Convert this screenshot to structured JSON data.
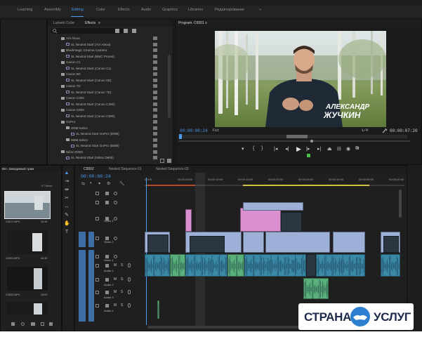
{
  "workspaces": [
    {
      "label": "Learning",
      "active": false
    },
    {
      "label": "Assembly",
      "active": false
    },
    {
      "label": "Editing",
      "active": true
    },
    {
      "label": "Color",
      "active": false
    },
    {
      "label": "Effects",
      "active": false
    },
    {
      "label": "Audio",
      "active": false
    },
    {
      "label": "Graphics",
      "active": false
    },
    {
      "label": "Libraries",
      "active": false
    },
    {
      "label": "Редактирование",
      "active": false
    },
    {
      "label": "»",
      "active": false
    }
  ],
  "effects_panel": {
    "tabs": [
      "Lumetri Color",
      "Effects"
    ],
    "search_placeholder": "",
    "tree": [
      {
        "label": "Arri Alexa",
        "kind": "folder",
        "indent": 1
      },
      {
        "label": "SL Neutral Start (Arri Alexa)",
        "kind": "fx",
        "indent": 2
      },
      {
        "label": "Blackmagic Cinema Camera",
        "kind": "folder",
        "indent": 1
      },
      {
        "label": "SL Neutral Start (BMC Prores)",
        "kind": "fx",
        "indent": 2
      },
      {
        "label": "Canon C1",
        "kind": "folder",
        "indent": 1
      },
      {
        "label": "SL Neutral Start (Canon C1)",
        "kind": "fx",
        "indent": 2
      },
      {
        "label": "Canon 5D",
        "kind": "folder",
        "indent": 1
      },
      {
        "label": "SL Neutral Start (Canon 5D)",
        "kind": "fx",
        "indent": 2
      },
      {
        "label": "Canon 7D",
        "kind": "folder",
        "indent": 1
      },
      {
        "label": "SL Neutral Start (Canon 7D)",
        "kind": "fx",
        "indent": 2
      },
      {
        "label": "Canon C300",
        "kind": "folder",
        "indent": 1
      },
      {
        "label": "SL Neutral Start (Canon C300)",
        "kind": "fx",
        "indent": 2
      },
      {
        "label": "Canon C500",
        "kind": "folder",
        "indent": 1
      },
      {
        "label": "SL Neutral Start (Canon C500)",
        "kind": "fx",
        "indent": 2
      },
      {
        "label": "GoPro",
        "kind": "folder",
        "indent": 1
      },
      {
        "label": "2098 Kelvin",
        "kind": "folder",
        "indent": 2
      },
      {
        "label": "SL Neutral Start GoPro (2098)",
        "kind": "fx",
        "indent": 3
      },
      {
        "label": "5668 Kelvin",
        "kind": "folder",
        "indent": 2
      },
      {
        "label": "SL Neutral Start GoPro (5668)",
        "kind": "fx",
        "indent": 3
      },
      {
        "label": "Nikon D800",
        "kind": "folder",
        "indent": 1
      },
      {
        "label": "SL Neutral Start (Nikon D800)",
        "kind": "fx",
        "indent": 2
      }
    ]
  },
  "program_monitor": {
    "title": "Program: C0001 ≡",
    "caption_line1": "АЛЕКСАНДР",
    "caption_line2": "ЖУЧКИН",
    "timecode_current": "00:00:00:24",
    "fit_label": "Fit",
    "resolution_label": "1/4",
    "timecode_duration": "00:00:07:20"
  },
  "project_panel": {
    "title": "Bin: Заводимый трим",
    "count_label": "97 Items",
    "clips": [
      {
        "name": "C0017.MP4",
        "duration": "10:44"
      },
      {
        "name": "C0001.MP4",
        "duration": "42:40"
      },
      {
        "name": "C0002.MP4",
        "duration": "19:00"
      },
      {
        "name": "C0003.MP4",
        "duration": "2:20"
      }
    ]
  },
  "timeline": {
    "tabs": [
      "C0002",
      "Nested Sequence 01",
      "Nested Sequence 03"
    ],
    "timecode": "00:00:00:24",
    "ruler_labels": [
      "00:00",
      "00:00:05:00",
      "00:00:10:00",
      "00:00:15:00",
      "00:00:20:00",
      "00:00:25:00",
      "00:00:30:00",
      "00:00:35:00",
      "00:00:40:00"
    ],
    "video_tracks": [
      "V4",
      "V3",
      "Video 3",
      "Video 2",
      "Video 1"
    ],
    "audio_tracks": [
      "Audio 1",
      "Audio 2",
      "Audio 3",
      "Audio 4"
    ]
  },
  "watermark": {
    "left_text": "СТРАНА",
    "right_text": "УСЛУГ"
  },
  "colors": {
    "accent": "#4a9cf0",
    "video_clip": "#9fb0d8",
    "pink_clip": "#d98fd0",
    "audio_clip": "#3a8aa7",
    "green_clip": "#59b07a",
    "track_button": "#3d6ea6"
  },
  "icons": [
    "search-icon",
    "folder-icon",
    "play-icon",
    "step-back-icon",
    "step-forward-icon",
    "wrench-icon",
    "marker-icon",
    "selection-tool-icon",
    "razor-tool-icon",
    "hand-tool-icon",
    "type-tool-icon",
    "eye-icon",
    "lock-icon",
    "mute-icon",
    "solo-icon",
    "mic-icon",
    "handshake-icon"
  ]
}
